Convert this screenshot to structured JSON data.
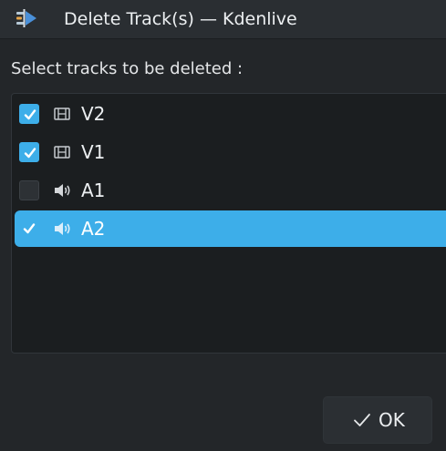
{
  "window": {
    "title": "Delete Track(s) — Kdenlive",
    "app_icon": "kdenlive-icon"
  },
  "dialog": {
    "prompt": "Select tracks to be deleted :",
    "tracks": [
      {
        "label": "V2",
        "type_icon": "video-track-icon",
        "checked": true,
        "selected": false
      },
      {
        "label": "V1",
        "type_icon": "video-track-icon",
        "checked": true,
        "selected": false
      },
      {
        "label": "A1",
        "type_icon": "audio-track-icon",
        "checked": false,
        "selected": false
      },
      {
        "label": "A2",
        "type_icon": "audio-track-icon",
        "checked": true,
        "selected": true
      }
    ],
    "ok_label": "OK",
    "ok_icon": "checkmark-icon"
  },
  "colors": {
    "accent": "#3daee9",
    "background": "#232629",
    "list_background": "#1b1e20"
  }
}
